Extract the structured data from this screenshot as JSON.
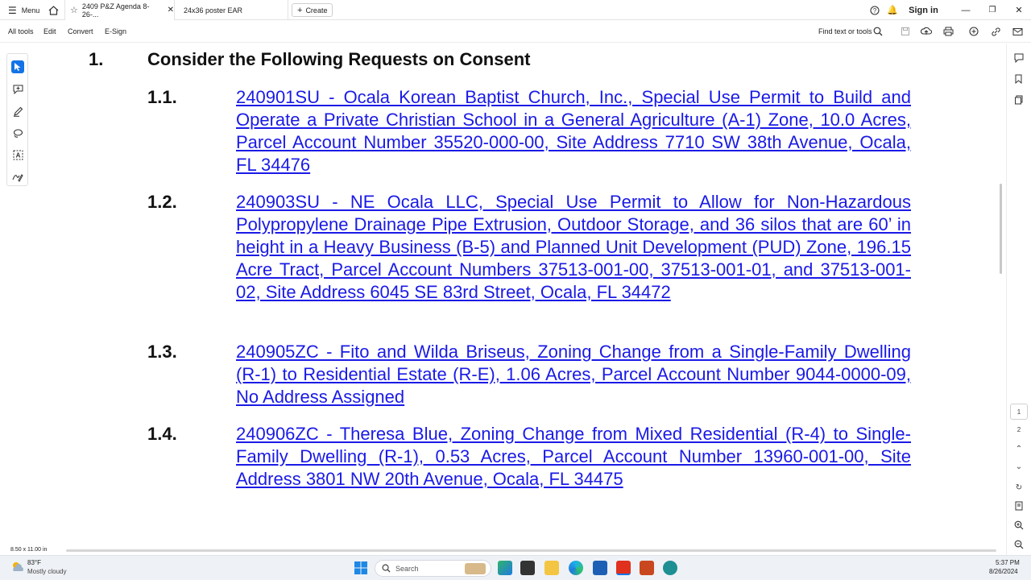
{
  "tabbar": {
    "menu_label": "Menu",
    "active_tab_title": "2409 P&Z Agenda 8-26-...",
    "second_tab_title": "24x36 poster EAR",
    "create_label": "Create",
    "sign_in_label": "Sign in"
  },
  "toolbar": {
    "items": [
      "All tools",
      "Edit",
      "Convert",
      "E-Sign"
    ],
    "find_label": "Find text or tools"
  },
  "document": {
    "section_number": "1.",
    "section_title": "Consider the Following Requests on Consent",
    "items": [
      {
        "number": "1.1.",
        "text": "240901SU - Ocala Korean Baptist Church, Inc., Special Use Permit to Build and Operate a Private Christian School in a General Agriculture (A-1) Zone, 10.0 Acres, Parcel Account Number 35520-000-00, Site Address 7710 SW 38th Avenue, Ocala, FL 34476"
      },
      {
        "number": "1.2.",
        "text": "240903SU - NE Ocala LLC, Special Use Permit to Allow for Non-Hazardous Polypropylene Drainage Pipe Extrusion, Outdoor Storage, and 36 silos that are 60’ in height in a Heavy Business (B-5) and Planned Unit Development (PUD) Zone, 196.15 Acre Tract, Parcel Account Numbers 37513-001-00, 37513-001-01, and 37513-001-02, Site Address 6045 SE 83rd Street, Ocala, FL 34472"
      },
      {
        "number": "1.3.",
        "text": "240905ZC - Fito and Wilda Briseus, Zoning Change from a Single-Family Dwelling (R-1) to Residential Estate (R-E), 1.06 Acres, Parcel Account Number 9044-0000-09, No Address Assigned"
      },
      {
        "number": "1.4.",
        "text": "240906ZC - Theresa Blue, Zoning Change from Mixed Residential (R-4) to Single-Family Dwelling (R-1), 0.53 Acres, Parcel Account Number 13960-001-00, Site Address 3801 NW 20th Avenue, Ocala, FL 34475"
      }
    ]
  },
  "rightrail": {
    "page_current": "1",
    "page_next": "2"
  },
  "statusbar": {
    "page_size": "8.50 x 11.00 in"
  },
  "taskbar": {
    "weather_temp": "83°F",
    "weather_desc": "Mostly cloudy",
    "search_placeholder": "Search",
    "time": "5:37 PM",
    "date": "8/26/2024"
  },
  "colors": {
    "link": "#1a1ae6",
    "accent_blue": "#1473e6",
    "acrobat_red": "#e0301e"
  }
}
